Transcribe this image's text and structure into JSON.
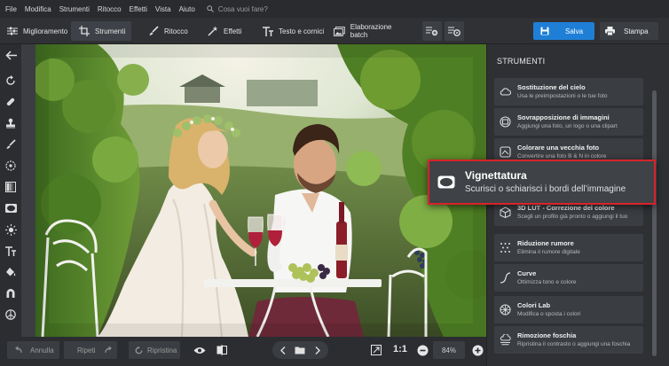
{
  "menubar": {
    "items": [
      "File",
      "Modifica",
      "Strumenti",
      "Ritocco",
      "Effetti",
      "Vista",
      "Aiuto"
    ],
    "search_placeholder": "Cosa vuoi fare?"
  },
  "toolbar": {
    "tabs": [
      "Miglioramento",
      "Strumenti",
      "Ritocco",
      "Effetti",
      "Testo e cornici",
      "Elaborazione batch"
    ],
    "save_label": "Salva",
    "print_label": "Stampa"
  },
  "bottombar": {
    "undo_label": "Annulla",
    "redo_label": "Ripeti",
    "reset_label": "Ripristina",
    "ratio_label": "1:1",
    "zoom_value": "84%"
  },
  "panel": {
    "title": "STRUMENTI",
    "cards": [
      {
        "title": "Sostituzione del cielo",
        "desc": "Usa le preimpostazioni o le tue foto",
        "icon": "cloud-icon"
      },
      {
        "title": "Sovrapposizione di immagini",
        "desc": "Aggiungi una foto, un logo o una clipart",
        "icon": "overlay-icon"
      },
      {
        "title": "Colorare una vecchia foto",
        "desc": "Convertire una foto B & N in colore",
        "icon": "colorize-icon"
      },
      {
        "title": "3D LUT - Correzione del colore",
        "desc": "Scegli un profilo già pronto o aggiungi il tuo",
        "icon": "lut-cube-icon"
      },
      {
        "title": "Riduzione rumore",
        "desc": "Elimina il rumore digitale",
        "icon": "noise-icon"
      },
      {
        "title": "Curve",
        "desc": "Ottimizza tono e colore",
        "icon": "curve-icon"
      },
      {
        "title": "Colori Lab",
        "desc": "Modifica o sposta i colori",
        "icon": "color-wheel-icon"
      },
      {
        "title": "Rimozione foschia",
        "desc": "Ripristina il contrasto o aggiungi una foschia",
        "icon": "haze-icon"
      }
    ]
  },
  "highlight": {
    "title": "Vignettatura",
    "desc": "Scurisci o schiarisci i bordi dell’immagine",
    "icon": "vignette-icon"
  },
  "colors": {
    "accent": "#1f7fd6",
    "highlight_border": "#d8232a"
  }
}
